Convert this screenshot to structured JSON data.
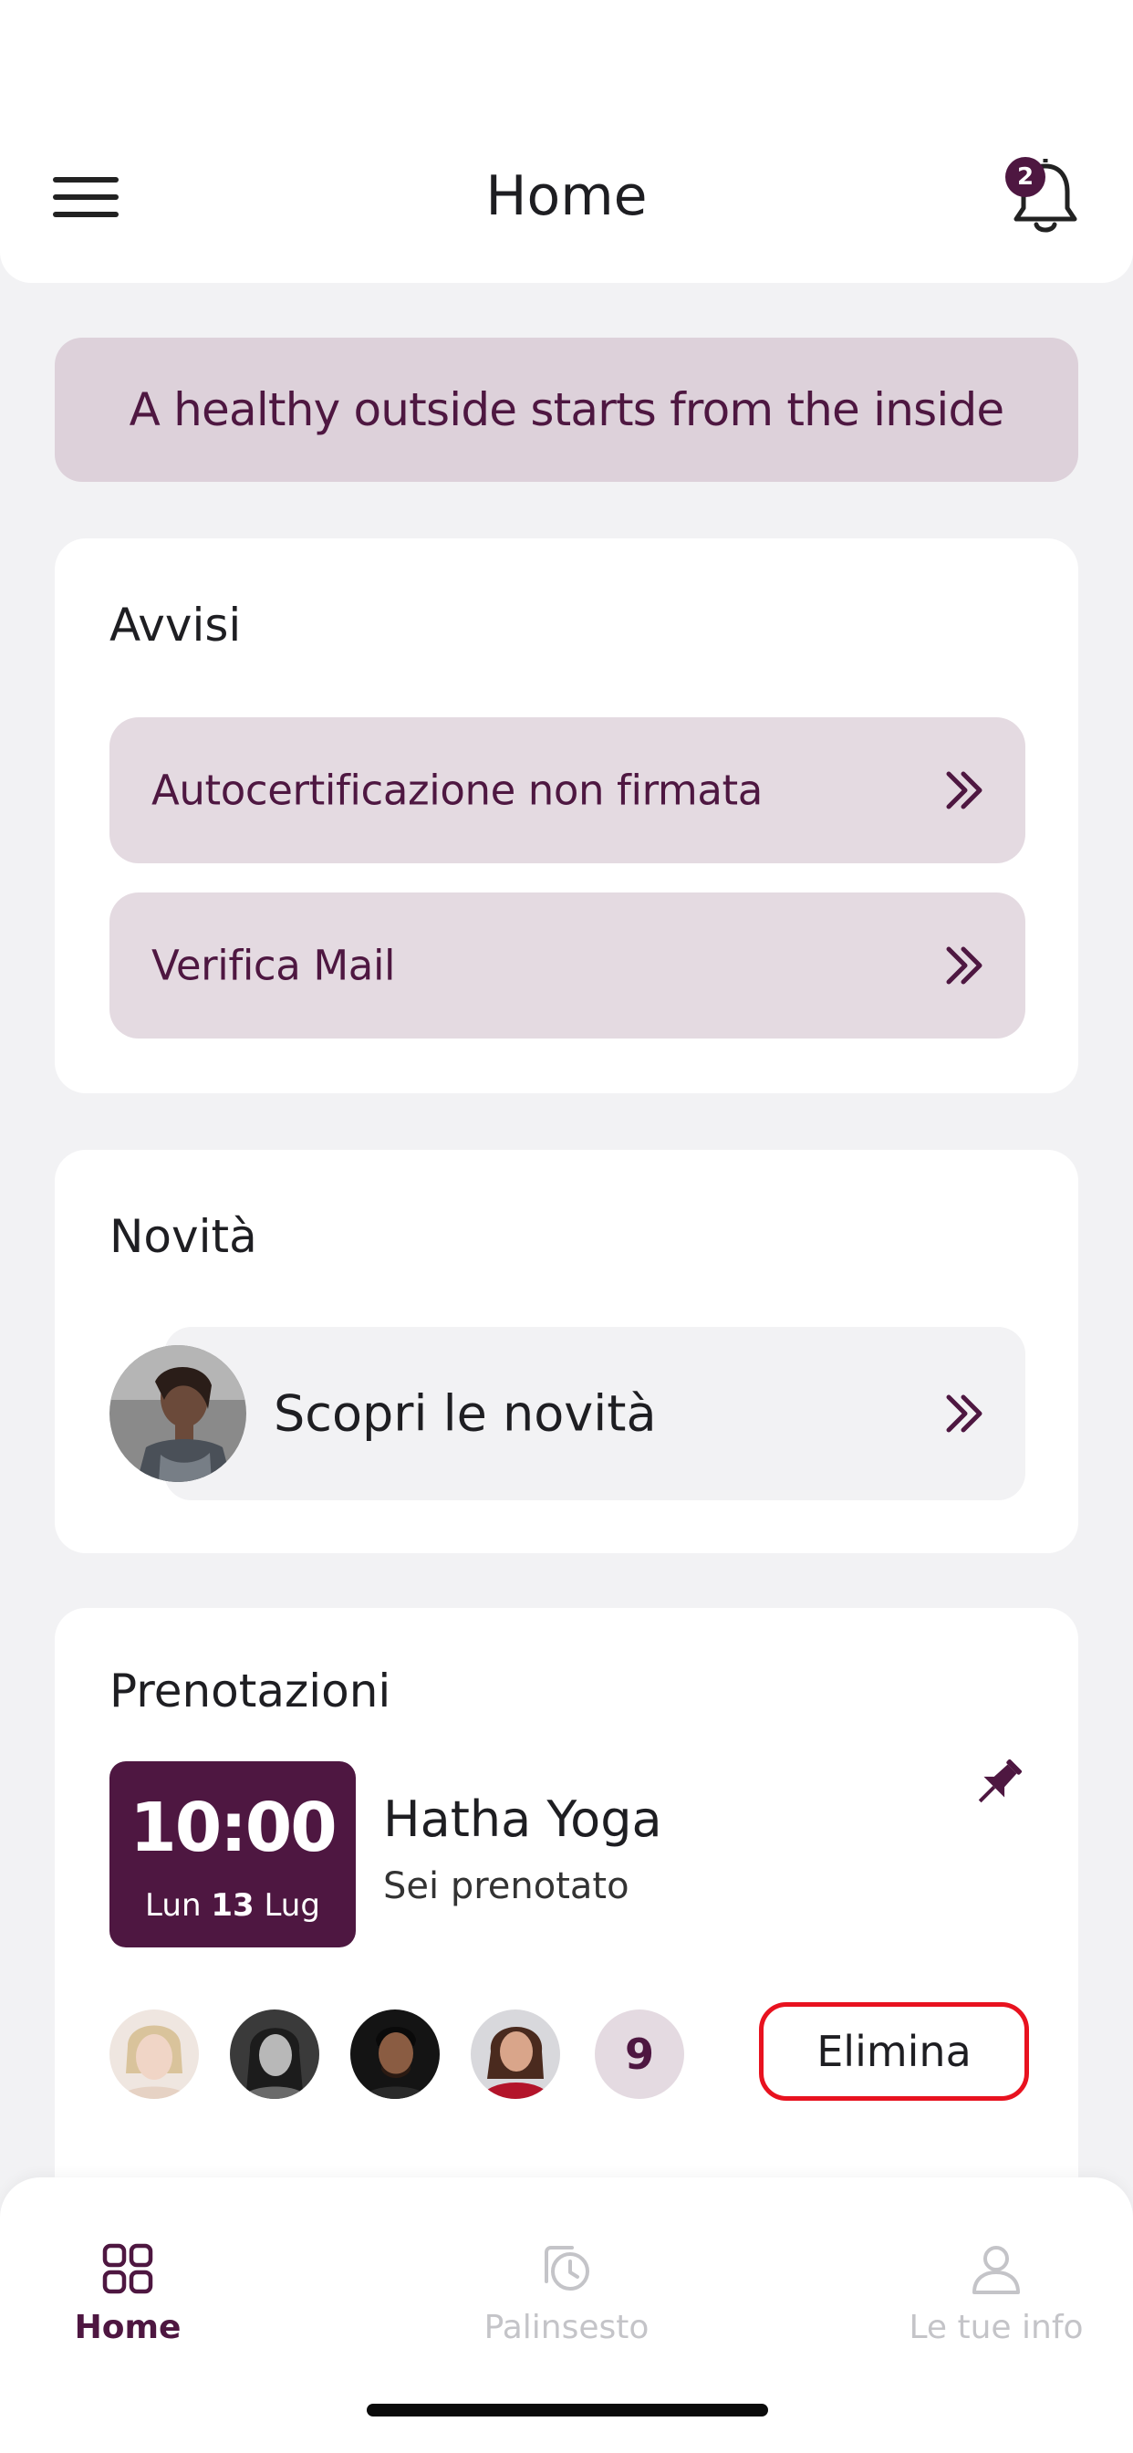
{
  "header": {
    "title": "Home",
    "notification_count": "2",
    "menu_icon": "hamburger-icon",
    "bell_icon": "bell-icon"
  },
  "banner": {
    "text": "A healthy outside starts from the inside"
  },
  "alerts": {
    "title": "Avvisi",
    "items": [
      {
        "label": "Autocertificazione non firmata",
        "icon": "double-chevron-right-icon"
      },
      {
        "label": "Verifica Mail",
        "icon": "double-chevron-right-icon"
      }
    ]
  },
  "news": {
    "title": "Novità",
    "item": {
      "label": "Scopri le novità",
      "icon": "double-chevron-right-icon"
    }
  },
  "bookings": {
    "title": "Prenotazioni",
    "booking": {
      "time": "10:00",
      "day": "Lun",
      "day_number": "13",
      "month": "Lug",
      "class_name": "Hatha Yoga",
      "status": "Sei prenotato",
      "pin_icon": "pin-icon",
      "attendee_count": "9",
      "delete_label": "Elimina"
    }
  },
  "tabs": [
    {
      "label": "Home",
      "icon": "grid-icon",
      "active": true
    },
    {
      "label": "Palinsesto",
      "icon": "schedule-history-icon",
      "active": false
    },
    {
      "label": "Le tue info",
      "icon": "user-icon",
      "active": false
    }
  ],
  "colors": {
    "brand": "#4e1741",
    "brand_light": "#e4dae1",
    "background": "#f2f2f4",
    "danger": "#e8121f",
    "inactive": "#c4c4c8"
  }
}
